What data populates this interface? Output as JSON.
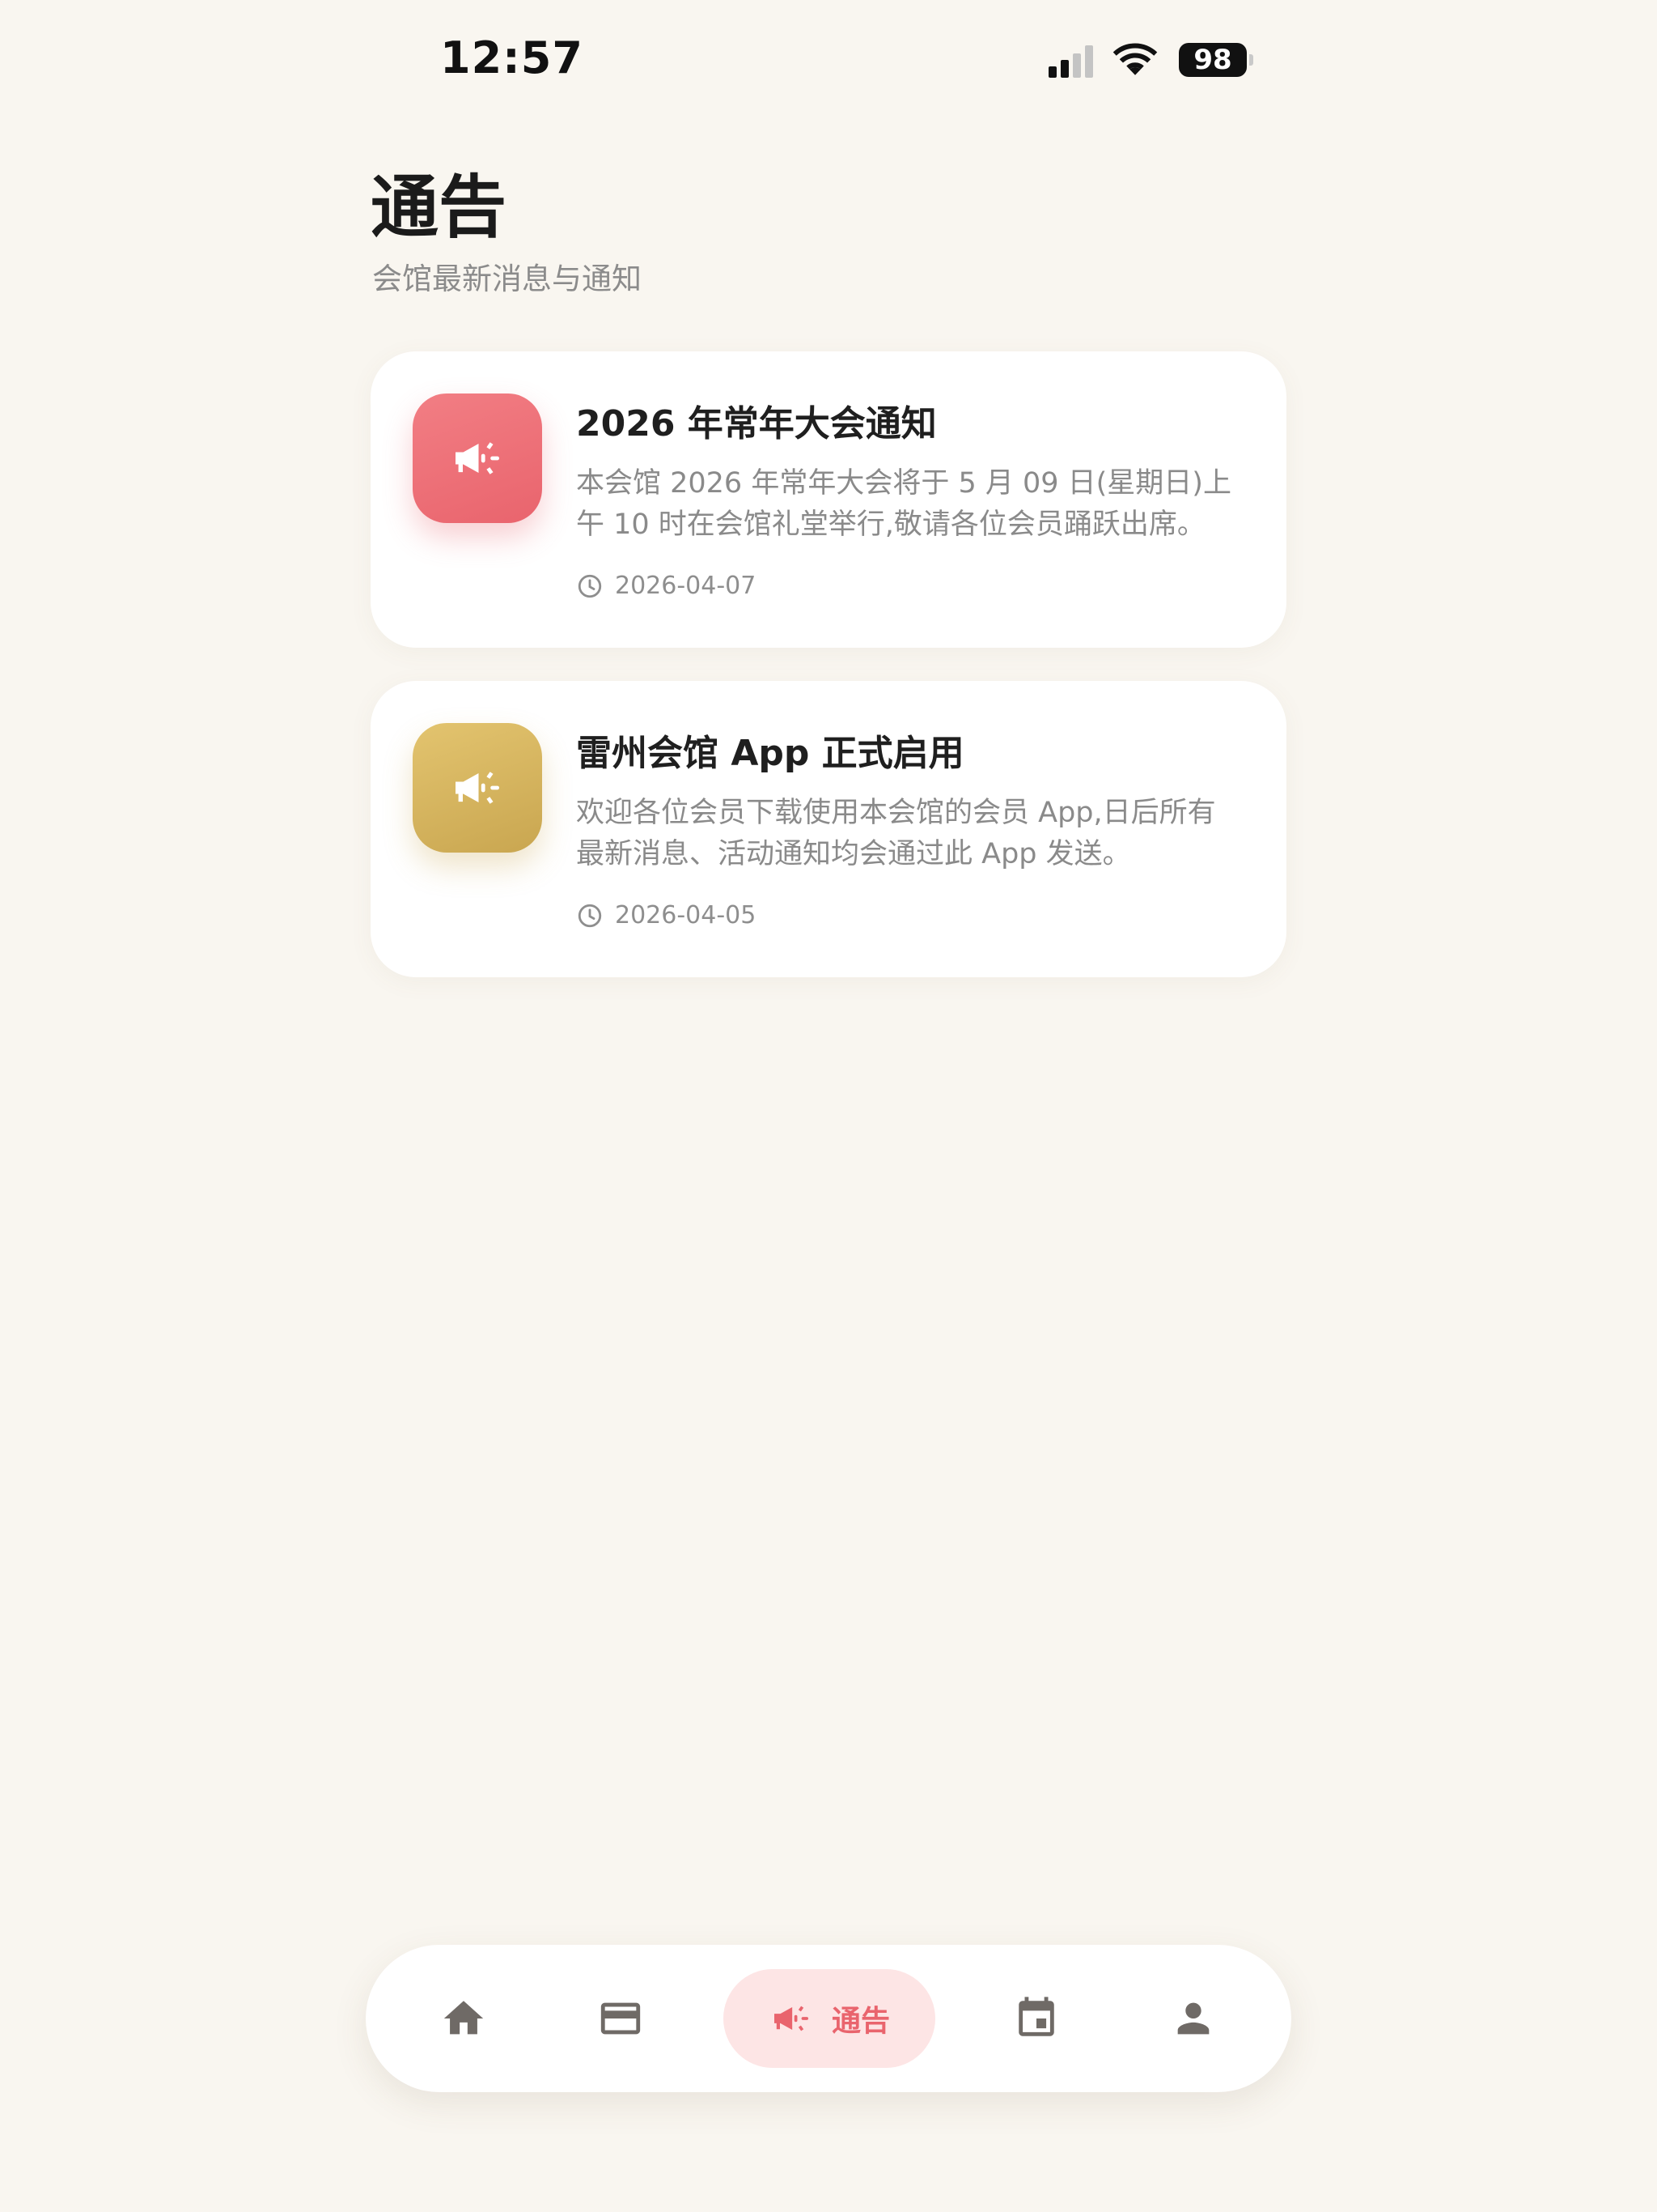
{
  "status_bar": {
    "time": "12:57",
    "battery": "98"
  },
  "header": {
    "title": "通告",
    "subtitle": "会馆最新消息与通知"
  },
  "notices": [
    {
      "title": "2026 年常年大会通知",
      "body": "本会馆 2026 年常年大会将于 5 月 09 日(星期日)上午 10 时在会馆礼堂举行,敬请各位会员踊跃出席。",
      "date": "2026-04-07",
      "icon": "megaphone-icon",
      "color": "#ec6d76"
    },
    {
      "title": "雷州会馆 App 正式启用",
      "body": "欢迎各位会员下载使用本会馆的会员 App,日后所有最新消息、活动通知均会通过此 App 发送。",
      "date": "2026-04-05",
      "icon": "megaphone-icon",
      "color": "#d4b25d"
    }
  ],
  "nav": {
    "items": [
      {
        "icon": "home-icon"
      },
      {
        "icon": "credit-card-icon"
      },
      {
        "icon": "megaphone-icon",
        "label": "通告",
        "active": true
      },
      {
        "icon": "calendar-icon"
      },
      {
        "icon": "person-icon"
      }
    ],
    "active_color": "#e9646d",
    "inactive_color": "#6f6a66"
  }
}
